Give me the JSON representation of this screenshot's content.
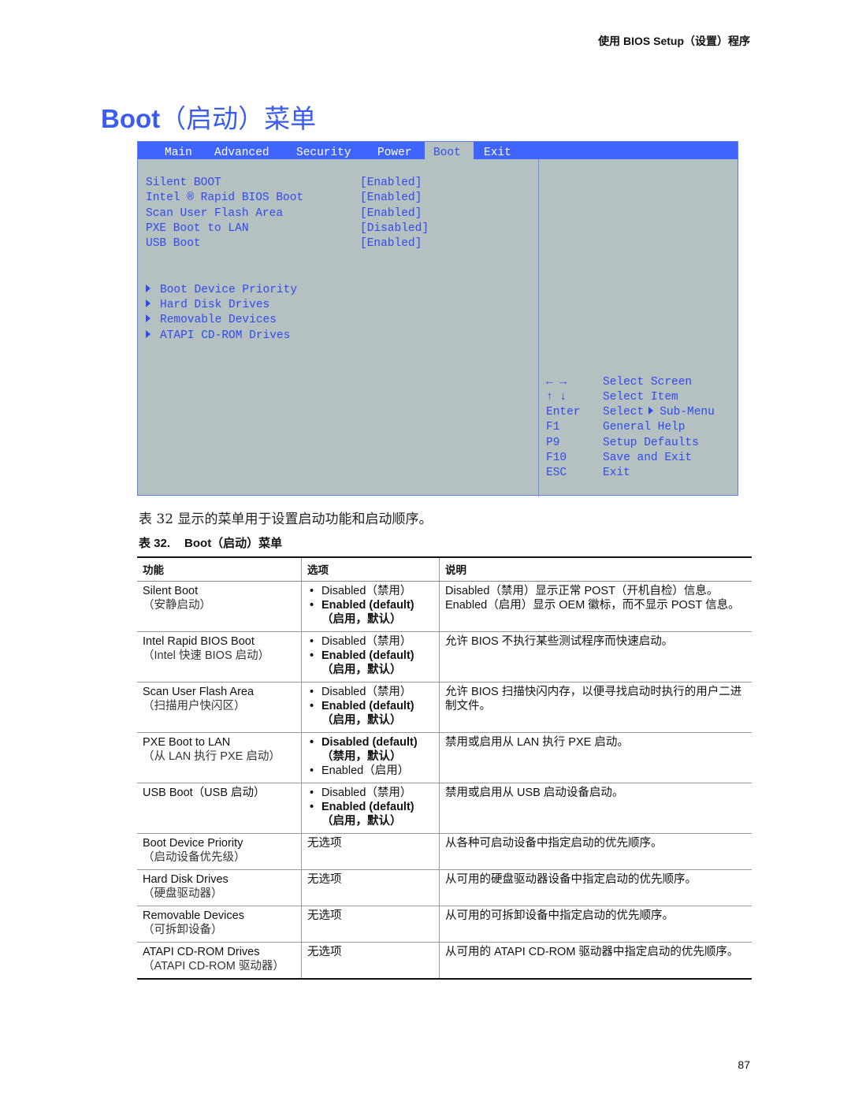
{
  "running_head": "使用 BIOS Setup（设置）程序",
  "page_title": {
    "en": "Boot",
    "cn": "（启动）菜单"
  },
  "bios": {
    "tabs": [
      {
        "label": "Main",
        "active": false
      },
      {
        "label": "Advanced",
        "active": false
      },
      {
        "label": "Security",
        "active": false
      },
      {
        "label": "Power",
        "active": false
      },
      {
        "label": "Boot",
        "active": true
      },
      {
        "label": "Exit",
        "active": false
      }
    ],
    "settings": [
      {
        "label": "Silent BOOT",
        "value": "[Enabled]"
      },
      {
        "label": "Intel ® Rapid BIOS Boot",
        "value": "[Enabled]"
      },
      {
        "label": "Scan User Flash Area",
        "value": "[Enabled]"
      },
      {
        "label": "PXE Boot to LAN",
        "value": "[Disabled]"
      },
      {
        "label": "USB Boot",
        "value": "[Enabled]"
      }
    ],
    "submenus": [
      {
        "label": "Boot Device Priority",
        "icon": "triangle-right-icon"
      },
      {
        "label": "Hard Disk Drives",
        "icon": "triangle-right-icon"
      },
      {
        "label": "Removable Devices",
        "icon": "triangle-right-icon"
      },
      {
        "label": "ATAPI CD-ROM Drives",
        "icon": "triangle-right-icon"
      }
    ],
    "keys": [
      {
        "key": "← →",
        "desc": "Select Screen"
      },
      {
        "key": "↑ ↓",
        "desc": "Select Item"
      },
      {
        "key": "Enter",
        "desc_pre": "Select",
        "desc_post": "Sub-Menu"
      },
      {
        "key": "F1",
        "desc": "General Help"
      },
      {
        "key": "P9",
        "desc": "Setup Defaults"
      },
      {
        "key": "F10",
        "desc": "Save and Exit"
      },
      {
        "key": "ESC",
        "desc": "Exit"
      }
    ],
    "colors": {
      "tab_bar": "#3f64ff",
      "panel": "#b5c0c0",
      "text": "#2f4bf0"
    }
  },
  "intro": "表 32 显示的菜单用于设置启动功能和启动顺序。",
  "table_caption": {
    "num": "表 32.",
    "title": "Boot（启动）菜单"
  },
  "table": {
    "headers": [
      "功能",
      "选项",
      "说明"
    ],
    "rows": [
      {
        "feature": "Silent Boot",
        "feature_cn": "（安静启动）",
        "options": [
          {
            "text": "Disabled（禁用）",
            "bold": false,
            "sub": ""
          },
          {
            "text": "Enabled (default)",
            "bold": true,
            "sub": "（启用，默认）"
          }
        ],
        "desc": "Disabled（禁用）显示正常 POST（开机自检）信息。Enabled（启用）显示 OEM 徽标，而不显示 POST 信息。"
      },
      {
        "feature": "Intel Rapid BIOS Boot",
        "feature_cn": "（Intel 快速 BIOS 启动）",
        "options": [
          {
            "text": "Disabled（禁用）",
            "bold": false,
            "sub": ""
          },
          {
            "text": "Enabled (default)",
            "bold": true,
            "sub": "（启用，默认）"
          }
        ],
        "desc": "允许 BIOS 不执行某些测试程序而快速启动。"
      },
      {
        "feature": "Scan User Flash Area",
        "feature_cn": "（扫描用户快闪区）",
        "options": [
          {
            "text": "Disabled（禁用）",
            "bold": false,
            "sub": ""
          },
          {
            "text": "Enabled (default)",
            "bold": true,
            "sub": "（启用，默认）"
          }
        ],
        "desc": "允许 BIOS 扫描快闪内存，以便寻找启动时执行的用户二进制文件。"
      },
      {
        "feature": "PXE Boot to LAN",
        "feature_cn": "（从 LAN 执行 PXE 启动）",
        "options": [
          {
            "text": "Disabled (default)",
            "bold": true,
            "sub": "（禁用，默认）"
          },
          {
            "text": "Enabled（启用）",
            "bold": false,
            "sub": ""
          }
        ],
        "desc": "禁用或启用从 LAN 执行 PXE 启动。"
      },
      {
        "feature": "USB Boot（USB 启动）",
        "feature_cn": "",
        "options": [
          {
            "text": "Disabled（禁用）",
            "bold": false,
            "sub": ""
          },
          {
            "text": "Enabled (default)",
            "bold": true,
            "sub": "（启用，默认）"
          }
        ],
        "desc": "禁用或启用从 USB 启动设备启动。"
      },
      {
        "feature": "Boot Device Priority",
        "feature_cn": "（启动设备优先级）",
        "no_option": "无选项",
        "desc": "从各种可启动设备中指定启动的优先顺序。"
      },
      {
        "feature": "Hard Disk Drives",
        "feature_cn": "（硬盘驱动器）",
        "no_option": "无选项",
        "desc": "从可用的硬盘驱动器设备中指定启动的优先顺序。"
      },
      {
        "feature": "Removable Devices",
        "feature_cn": "（可拆卸设备）",
        "no_option": "无选项",
        "desc": "从可用的可拆卸设备中指定启动的优先顺序。"
      },
      {
        "feature": "ATAPI CD-ROM Drives",
        "feature_cn": "（ATAPI CD-ROM 驱动器）",
        "no_option": "无选项",
        "desc": "从可用的 ATAPI CD-ROM 驱动器中指定启动的优先顺序。"
      }
    ]
  },
  "page_number": "87"
}
